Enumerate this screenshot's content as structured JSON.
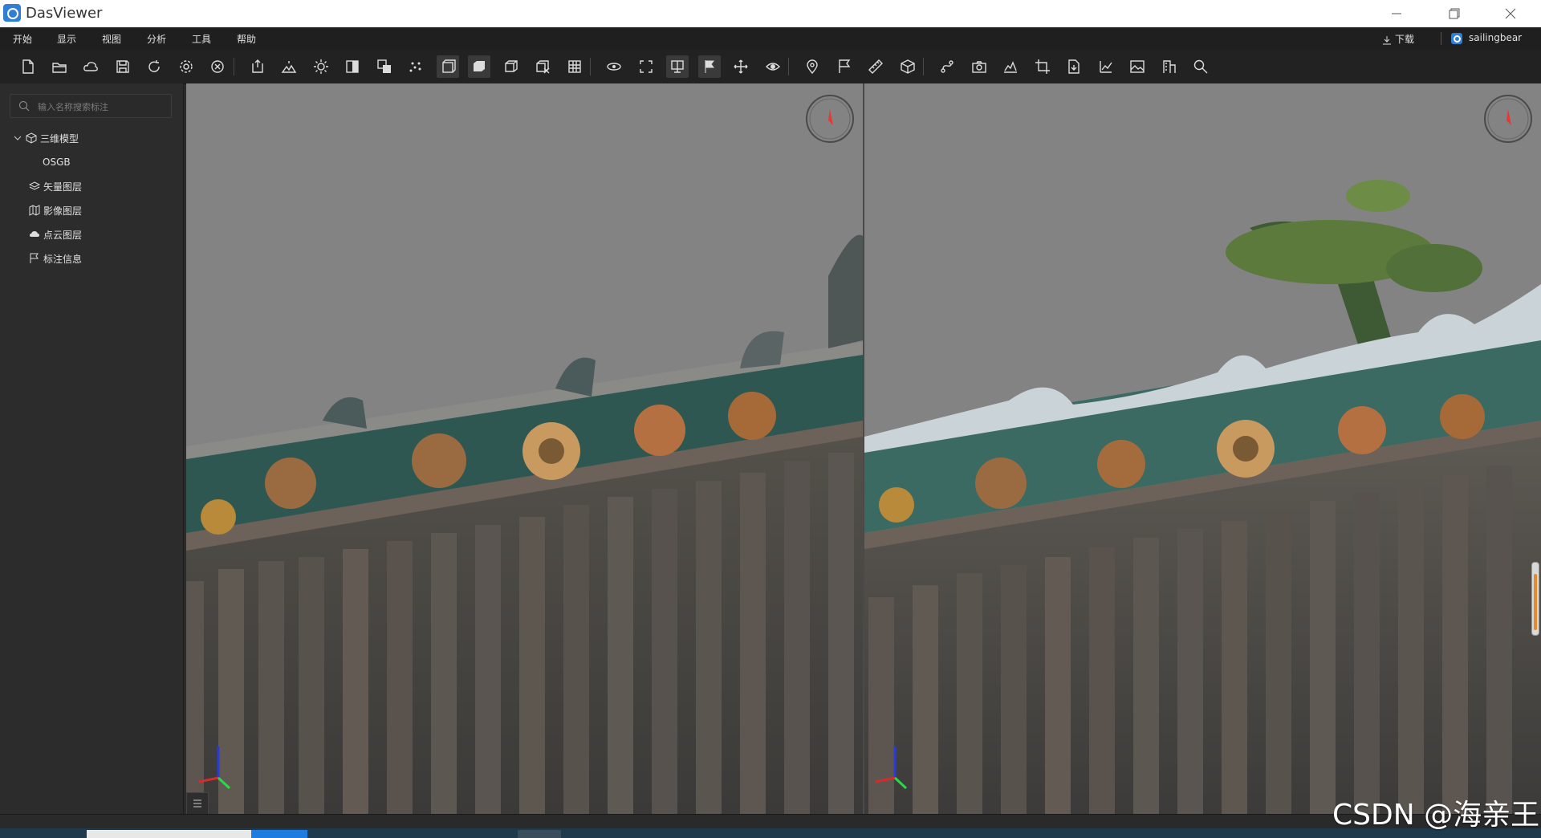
{
  "app": {
    "title": "DasViewer"
  },
  "window_controls": {
    "minimize": "minimize-icon",
    "restore": "restore-icon",
    "close": "close-icon"
  },
  "menu": {
    "items": [
      "开始",
      "显示",
      "视图",
      "分析",
      "工具",
      "帮助"
    ],
    "download": "下载",
    "user": "sailingbear"
  },
  "toolbar": {
    "groups": [
      [
        "new-file-icon",
        "open-folder-icon",
        "cloud-icon",
        "save-icon",
        "refresh-icon",
        "settings-icon",
        "close-circle-icon"
      ],
      [
        "import-model-icon",
        "terrain-icon",
        "sun-icon",
        "split-view-icon",
        "layer-compare-icon",
        "points-icon",
        "front-view-icon",
        "solid-box-icon",
        "wire-box-icon",
        "box-clip-icon",
        "grid-icon"
      ],
      [
        "orbit-icon",
        "fullscreen-icon",
        "screen-split-icon",
        "flag-marker-icon",
        "pan-icon",
        "eye-rotate-icon"
      ],
      [
        "pin-icon",
        "flag-icon",
        "ruler-icon",
        "volume-icon"
      ],
      [
        "route-icon",
        "camera-icon",
        "profile-icon",
        "crop-icon",
        "export-icon",
        "chart-icon",
        "image-icon",
        "building-icon",
        "search-icon"
      ]
    ],
    "active": [
      "front-view-icon",
      "solid-box-icon",
      "screen-split-icon",
      "flag-marker-icon"
    ]
  },
  "sidebar": {
    "search_placeholder": "输入名称搜索标注",
    "tree": [
      {
        "label": "三维模型",
        "icon": "cube-icon",
        "expanded": true,
        "children": [
          {
            "label": "OSGB"
          }
        ]
      },
      {
        "label": "矢量图层",
        "icon": "layers-icon"
      },
      {
        "label": "影像图层",
        "icon": "map-icon"
      },
      {
        "label": "点云图层",
        "icon": "cloud-points-icon"
      },
      {
        "label": "标注信息",
        "icon": "flag-icon"
      }
    ]
  },
  "colors": {
    "sky": "#838383",
    "tile": "#4c4a47",
    "accent": "#2f7fd8",
    "compass_needle": "#e53935"
  },
  "watermark": "CSDN @海亲王"
}
